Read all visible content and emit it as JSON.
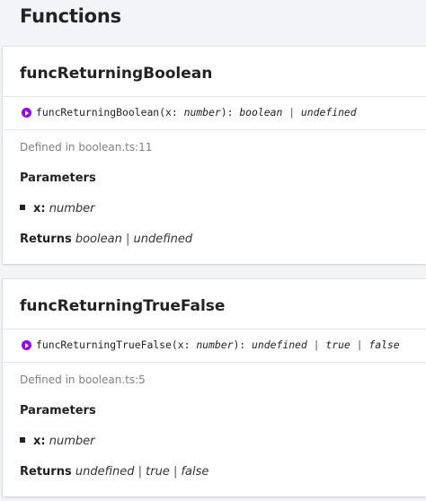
{
  "header": {
    "title": "Functions"
  },
  "functions": [
    {
      "name": "funcReturningBoolean",
      "signature": {
        "name": "funcReturningBoolean",
        "open": "(x: ",
        "param_type": "number",
        "close": "): ",
        "return_types": [
          "boolean",
          "undefined"
        ]
      },
      "defined_in": "Defined in boolean.ts:11",
      "parameters_heading": "Parameters",
      "parameters": [
        {
          "name": "x:",
          "type": "number"
        }
      ],
      "returns_label": "Returns",
      "return_types": [
        "boolean",
        "undefined"
      ]
    },
    {
      "name": "funcReturningTrueFalse",
      "signature": {
        "name": "funcReturningTrueFalse",
        "open": "(x: ",
        "param_type": "number",
        "close": "): ",
        "return_types": [
          "undefined",
          "true",
          "false"
        ]
      },
      "defined_in": "Defined in boolean.ts:5",
      "parameters_heading": "Parameters",
      "parameters": [
        {
          "name": "x:",
          "type": "number"
        }
      ],
      "returns_label": "Returns",
      "return_types": [
        "undefined",
        "true",
        "false"
      ]
    }
  ],
  "separator": " | ",
  "colors": {
    "signature_icon": "#9600ff",
    "muted_text": "#808080"
  },
  "icons": {
    "signature": "function-signature-icon"
  }
}
